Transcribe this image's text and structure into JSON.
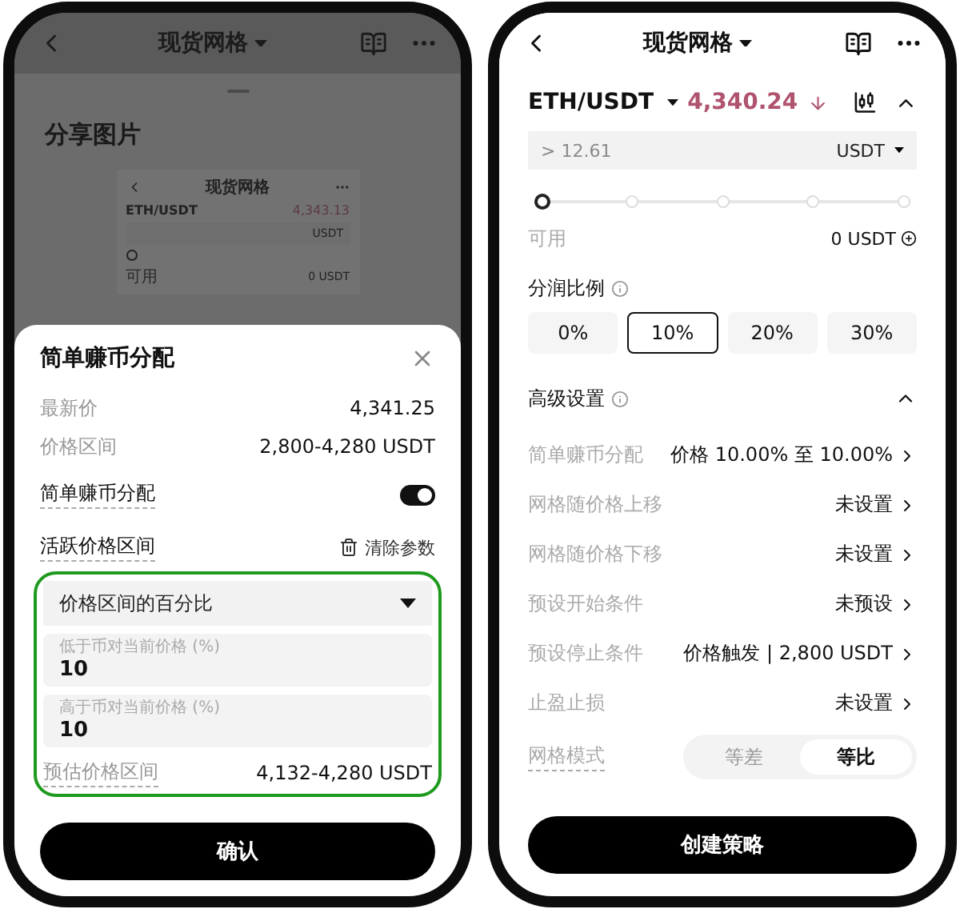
{
  "left_phone": {
    "header": {
      "title": "现货网格"
    },
    "share_sheet": {
      "title": "分享图片",
      "preview": {
        "title": "现货网格",
        "pair": "ETH/USDT",
        "price": "4,343.13",
        "unit": "USDT",
        "available_label": "可用",
        "available_value": "0 USDT"
      }
    },
    "modal": {
      "title": "简单赚币分配",
      "info_rows": [
        {
          "label": "最新价",
          "value": "4,341.25"
        },
        {
          "label": "价格区间",
          "value": "2,800-4,280 USDT"
        }
      ],
      "toggle": {
        "label": "简单赚币分配",
        "on": true
      },
      "section": {
        "label": "活跃价格区间",
        "action": "清除参数"
      },
      "highlighted": true,
      "dropdown": {
        "value": "价格区间的百分比"
      },
      "inputs": [
        {
          "label": "低于币对当前价格 (%)",
          "value": "10"
        },
        {
          "label": "高于币对当前价格 (%)",
          "value": "10"
        }
      ],
      "estimate": {
        "label": "预估价格区间",
        "value": "4,132-4,280 USDT"
      },
      "confirm_button": "确认"
    }
  },
  "right_phone": {
    "header": {
      "title": "现货网格"
    },
    "pair": {
      "name": "ETH/USDT",
      "price": "4,340.24"
    },
    "amount_field": {
      "placeholder": "> 12.61",
      "unit": "USDT"
    },
    "slider": {
      "level": 0
    },
    "available": {
      "label": "可用",
      "value": "0 USDT"
    },
    "profit_share": {
      "title": "分润比例",
      "options": [
        {
          "label": "0%",
          "selected": false
        },
        {
          "label": "10%",
          "selected": true
        },
        {
          "label": "20%",
          "selected": false
        },
        {
          "label": "30%",
          "selected": false
        }
      ]
    },
    "advanced": {
      "title": "高级设置",
      "expanded": true,
      "rows": [
        {
          "label": "简单赚币分配",
          "value": "价格 10.00% 至 10.00%"
        },
        {
          "label": "网格随价格上移",
          "value": "未设置"
        },
        {
          "label": "网格随价格下移",
          "value": "未设置"
        },
        {
          "label": "预设开始条件",
          "value": "未预设"
        },
        {
          "label": "预设停止条件",
          "value": "价格触发 | 2,800 USDT"
        },
        {
          "label": "止盈止损",
          "value": "未设置"
        }
      ],
      "grid_mode": {
        "label": "网格模式",
        "options": [
          {
            "label": "等差",
            "selected": false
          },
          {
            "label": "等比",
            "selected": true
          }
        ]
      }
    },
    "create_button": "创建策略"
  }
}
